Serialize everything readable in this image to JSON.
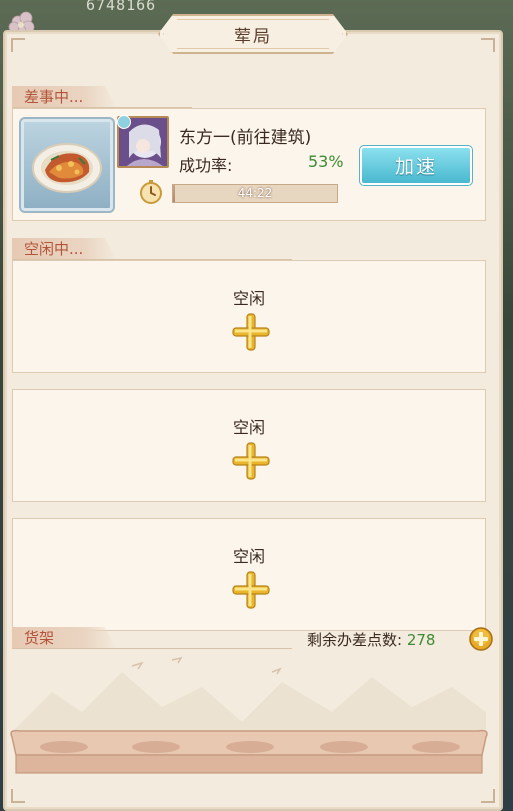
{
  "top_counter": "6748166",
  "window": {
    "title": "荤局"
  },
  "busy_section": {
    "header": "差事中...",
    "task": {
      "name": "东方一(前往建筑)",
      "success_rate_label": "成功率:",
      "success_rate_value": "53%",
      "speedup_label": "加速",
      "timer_text": "44:22",
      "progress_fraction": 0.01
    }
  },
  "idle_section": {
    "header": "空闲中...",
    "slots": [
      {
        "label": "空闲"
      },
      {
        "label": "空闲"
      },
      {
        "label": "空闲"
      }
    ]
  },
  "shelf_section": {
    "header": "货架",
    "remaining_label": "剩余办差点数:",
    "remaining_value": "278"
  },
  "colors": {
    "panel_bg": "#f3ebdd",
    "accent_red": "#b2553a",
    "success_green": "#3f8a32",
    "speedup_blue": "#49b8cf"
  },
  "icons": [
    "stopwatch-icon",
    "plus-icon",
    "gold-plus-icon",
    "plum-blossom-icon"
  ]
}
